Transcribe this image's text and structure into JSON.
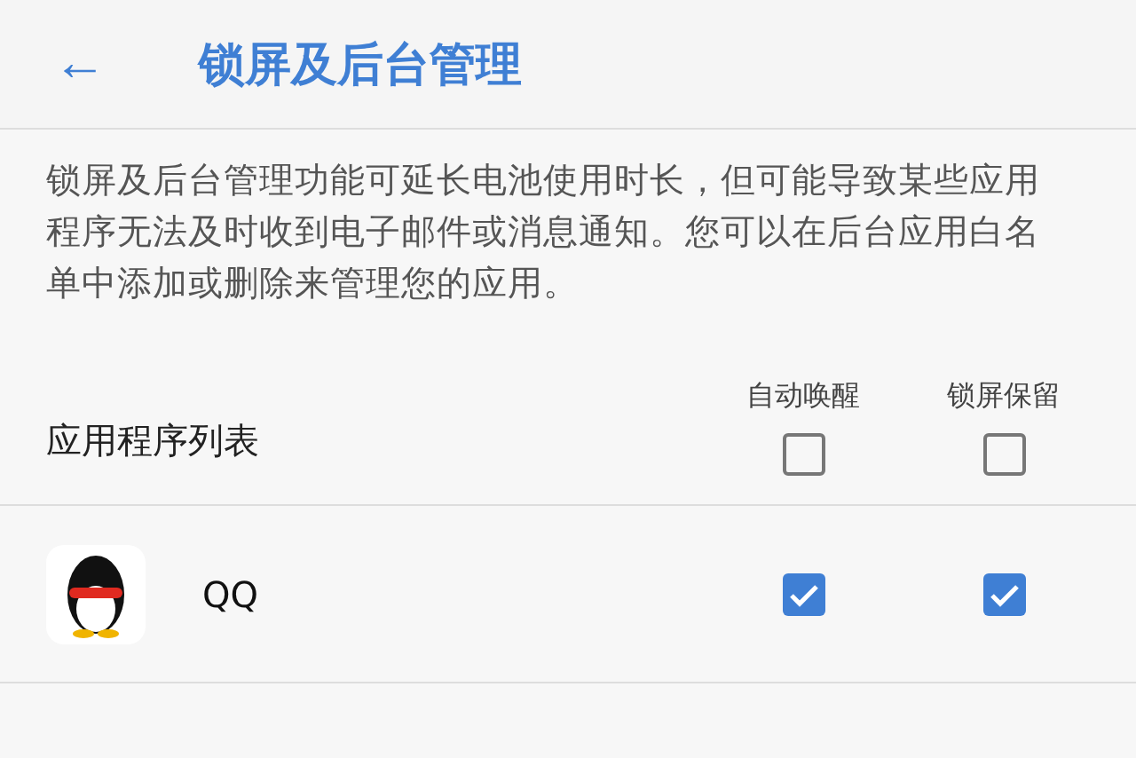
{
  "header": {
    "back": "←",
    "title": "锁屏及后台管理"
  },
  "description": "锁屏及后台管理功能可延长电池使用时长，但可能导致某些应用程序无法及时收到电子邮件或消息通知。您可以在后台应用白名单中添加或删除来管理您的应用。",
  "list": {
    "title": "应用程序列表",
    "columns": [
      "自动唤醒",
      "锁屏保留"
    ],
    "select_all": [
      {
        "checked": false
      },
      {
        "checked": false
      }
    ]
  },
  "apps": [
    {
      "name": "QQ",
      "checks": [
        {
          "checked": true
        },
        {
          "checked": true
        }
      ]
    }
  ]
}
